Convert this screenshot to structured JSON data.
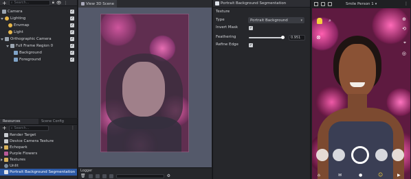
{
  "objects": {
    "items": [
      {
        "label": "Camera"
      },
      {
        "label": "Lighting"
      },
      {
        "label": "Envmap"
      },
      {
        "label": "Light"
      },
      {
        "label": "Orthographic Camera"
      },
      {
        "label": "Full Frame Region 0"
      },
      {
        "label": "Background"
      },
      {
        "label": "Foreground"
      }
    ],
    "search_placeholder": "Search..."
  },
  "resources": {
    "tabs": [
      {
        "label": "Resources"
      },
      {
        "label": "Scene Config"
      }
    ],
    "search_placeholder": "Search...",
    "items": [
      {
        "label": "Render Target"
      },
      {
        "label": "Device Camera Texture"
      },
      {
        "label": "Echopark"
      },
      {
        "label": "Purple Flowers"
      },
      {
        "label": "Textures"
      },
      {
        "label": "Unlit"
      },
      {
        "label": "Portrait Background Segmentation"
      }
    ]
  },
  "scene": {
    "tab_label": "View 3D Scene"
  },
  "logger": {
    "title": "Logger"
  },
  "inspector": {
    "title": "Portrait Background Segmentation",
    "section": "Texture",
    "type_label": "Type",
    "type_value": "Portrait Background",
    "invert_label": "Invert Mask",
    "feather_label": "Feathering",
    "feather_value": "0.951",
    "refine_label": "Refine Edge"
  },
  "preview": {
    "device_label": "Smile Person 1",
    "colors": {
      "accent": "#f4d03f",
      "selection": "#2d5aa6"
    }
  }
}
